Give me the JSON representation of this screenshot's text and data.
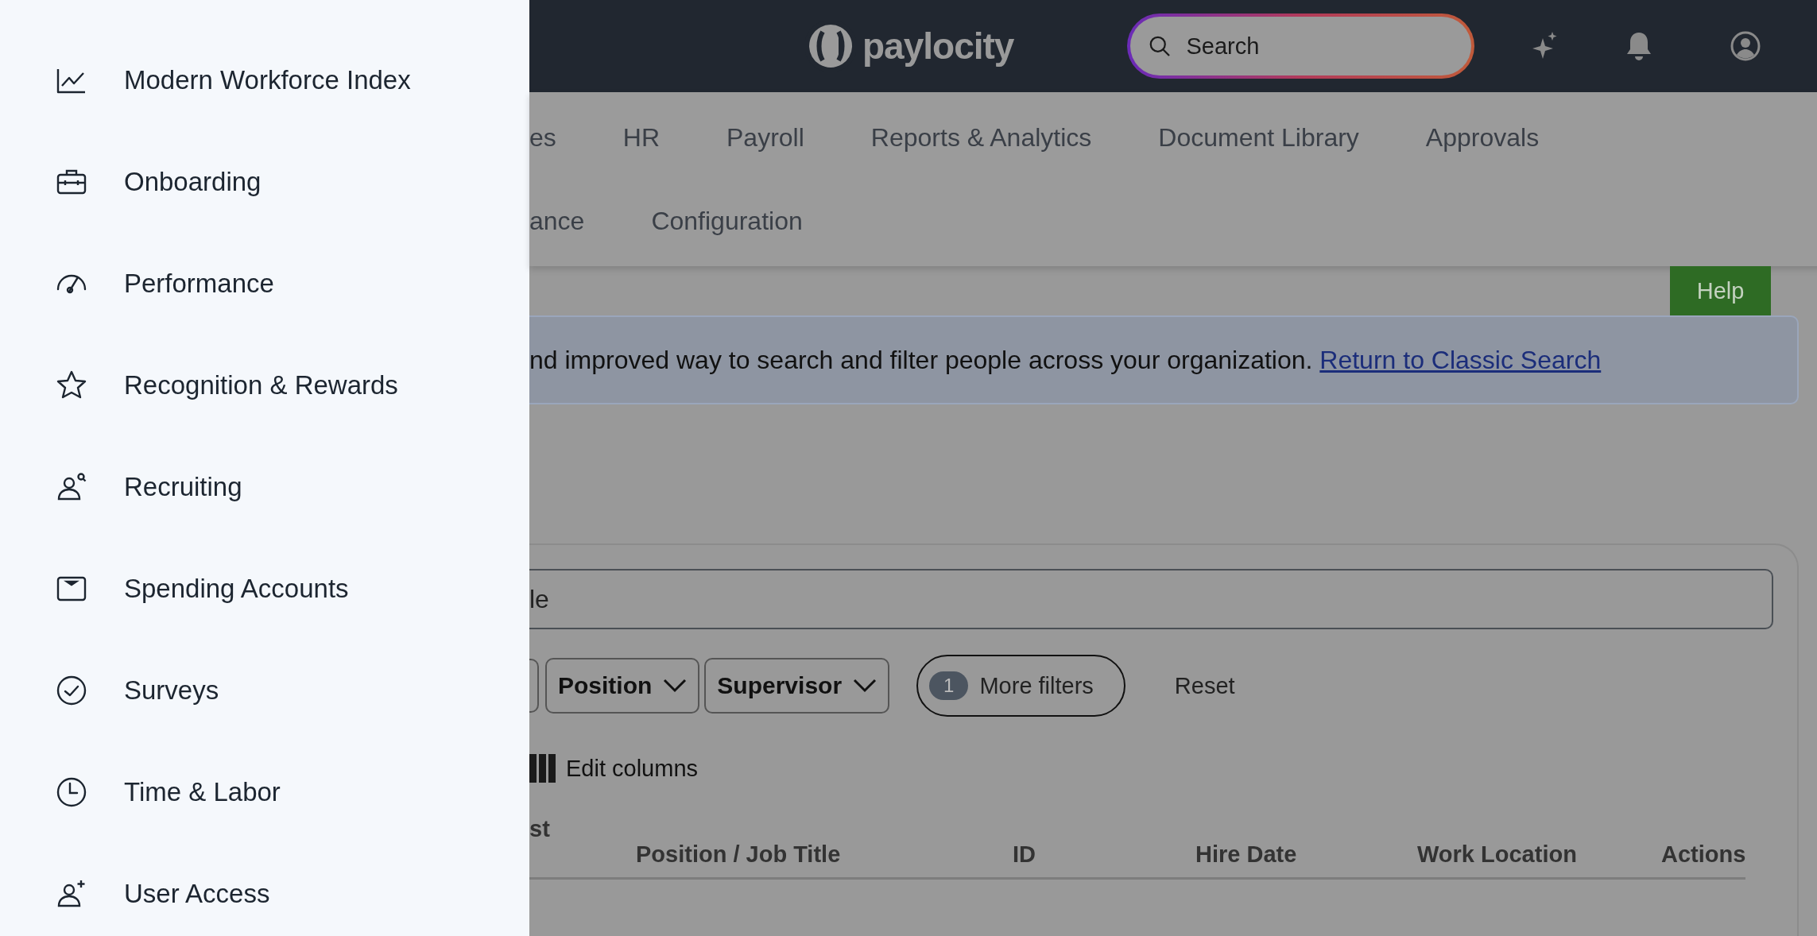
{
  "drawer": {
    "items": [
      {
        "label": "Modern Workforce Index"
      },
      {
        "label": "Onboarding"
      },
      {
        "label": "Performance"
      },
      {
        "label": "Recognition & Rewards"
      },
      {
        "label": "Recruiting"
      },
      {
        "label": "Spending Accounts"
      },
      {
        "label": "Surveys"
      },
      {
        "label": "Time & Labor"
      },
      {
        "label": "User Access"
      }
    ]
  },
  "header": {
    "logo": "paylocity",
    "search": {
      "placeholder": "Search"
    }
  },
  "nav": {
    "rows": [
      [
        "es",
        "HR",
        "Payroll",
        "Reports & Analytics",
        "Document Library",
        "Approvals"
      ],
      [
        "ance",
        "Configuration"
      ]
    ]
  },
  "help_button": "Help",
  "banner": {
    "text": "nd improved way to search and filter people across your organization.",
    "link": "Return to Classic Search"
  },
  "search_field": {
    "value": "le"
  },
  "filters": [
    "Position",
    "Supervisor"
  ],
  "more_filters": {
    "count": "1",
    "label": "More filters"
  },
  "reset": "Reset",
  "edit_columns": "Edit columns",
  "table": {
    "columns": [
      "st",
      "Position / Job Title",
      "ID",
      "Hire Date",
      "Work Location",
      "Actions"
    ]
  }
}
